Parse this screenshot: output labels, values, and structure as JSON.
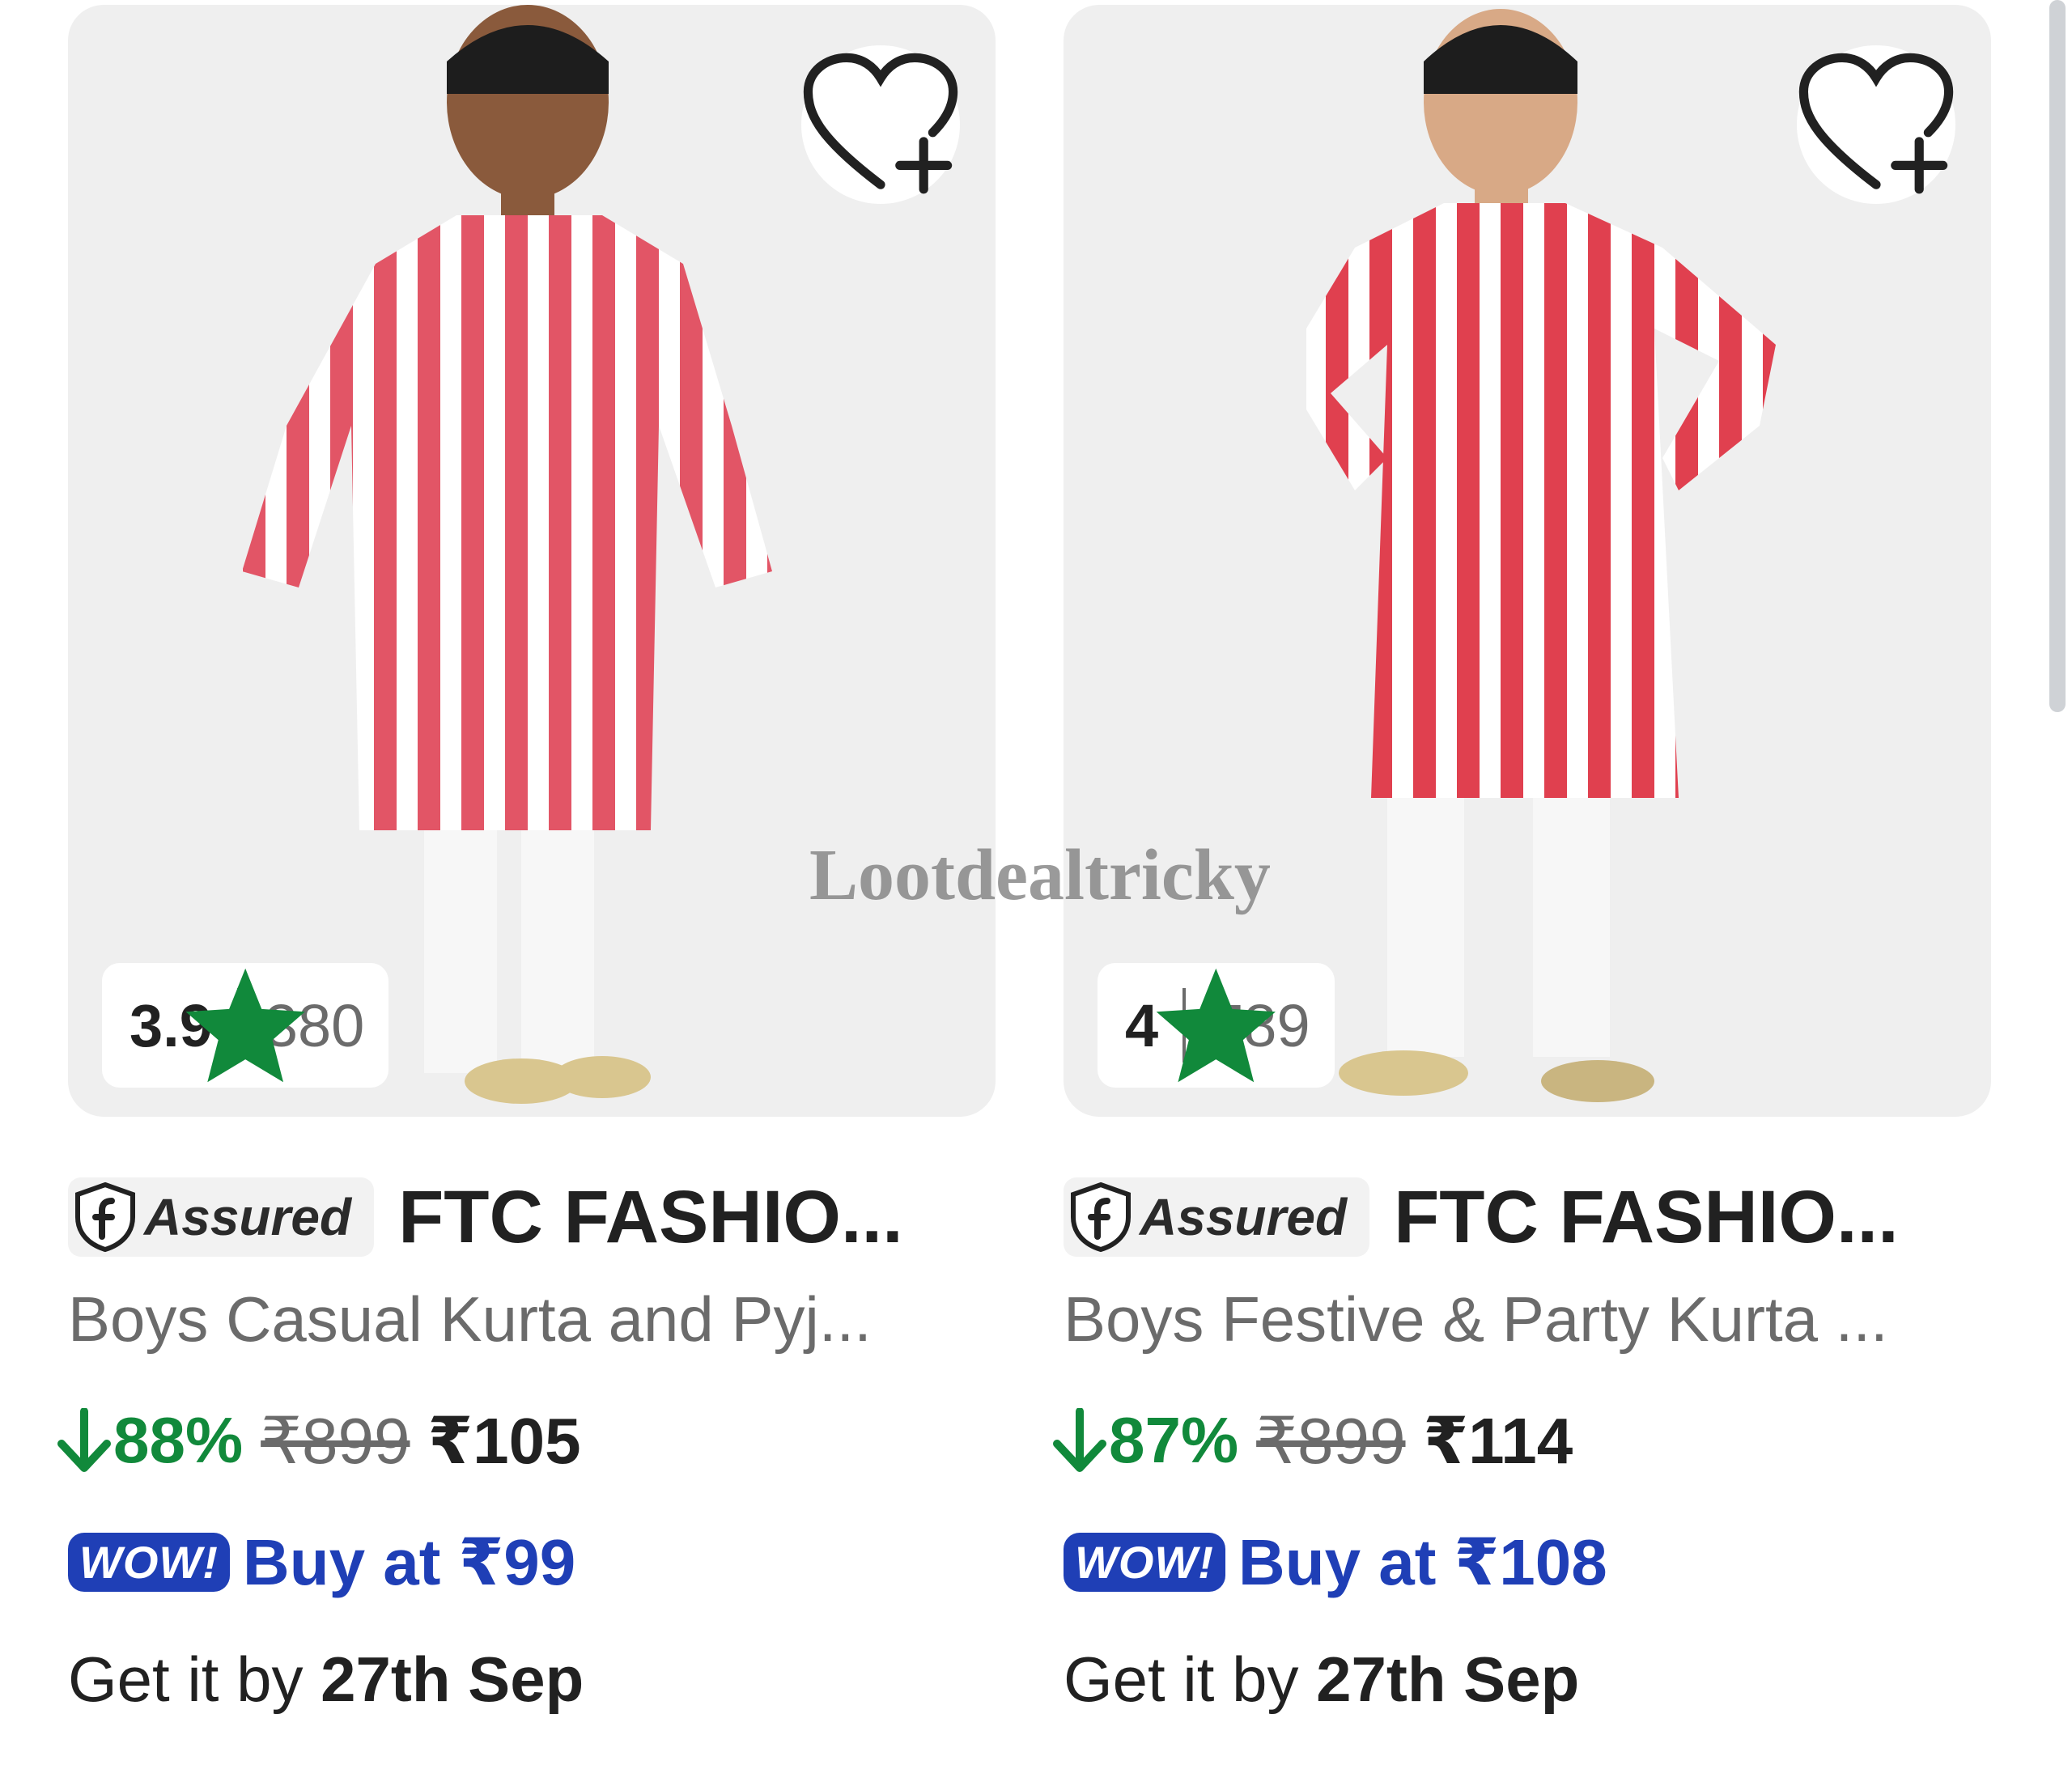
{
  "products": [
    {
      "rating": "3.9",
      "rating_count": "380",
      "assured_label": "Assured",
      "brand": "FTC FASHIO...",
      "subtitle": "Boys Casual Kurta and Pyj...",
      "discount": "88%",
      "mrp": "₹899",
      "price": "₹105",
      "wow_badge": "WOW!",
      "wow_text": "Buy at ₹99",
      "delivery_prefix": "Get it by ",
      "delivery_date": "27th Sep"
    },
    {
      "rating": "4",
      "rating_count": "789",
      "assured_label": "Assured",
      "brand": "FTC FASHIO...",
      "subtitle": "Boys Festive & Party Kurta ...",
      "discount": "87%",
      "mrp": "₹899",
      "price": "₹114",
      "wow_badge": "WOW!",
      "wow_text": "Buy at ₹108",
      "delivery_prefix": "Get it by ",
      "delivery_date": "27th Sep"
    }
  ],
  "watermark": "Lootdealtricky",
  "colors": {
    "discount_green": "#11893b",
    "wow_blue": "#1f3fb6",
    "star_green": "#11893b",
    "kurta_red": "#e25566"
  },
  "icons": [
    "wishlist-add-icon",
    "star-icon",
    "assured-shield-icon",
    "down-arrow-icon"
  ]
}
